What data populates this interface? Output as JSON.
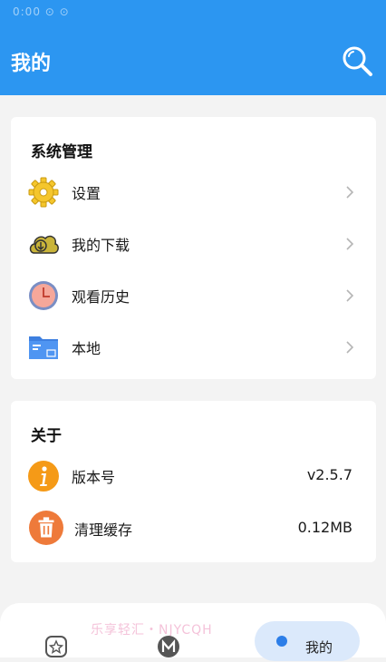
{
  "status_bar": {
    "text": "0:00 ⊙ ⊙"
  },
  "header": {
    "title": "我的"
  },
  "system_section": {
    "title": "系统管理",
    "items": [
      {
        "label": "设置",
        "icon": "gear-icon"
      },
      {
        "label": "我的下载",
        "icon": "download-cloud-icon"
      },
      {
        "label": "观看历史",
        "icon": "clock-icon"
      },
      {
        "label": "本地",
        "icon": "folder-icon"
      }
    ]
  },
  "about_section": {
    "title": "关于",
    "items": [
      {
        "label": "版本号",
        "value": "v2.5.7",
        "icon": "info-icon"
      },
      {
        "label": "清理缓存",
        "value": "0.12MB",
        "icon": "trash-icon"
      }
    ]
  },
  "bottom_nav": {
    "watermark": "乐享轻汇・NJYCQH",
    "active_label": "我的"
  },
  "colors": {
    "accent": "#2c96f1",
    "background": "#f3f3f3",
    "info_orange": "#f59a17",
    "trash_orange": "#ee7a3a"
  }
}
